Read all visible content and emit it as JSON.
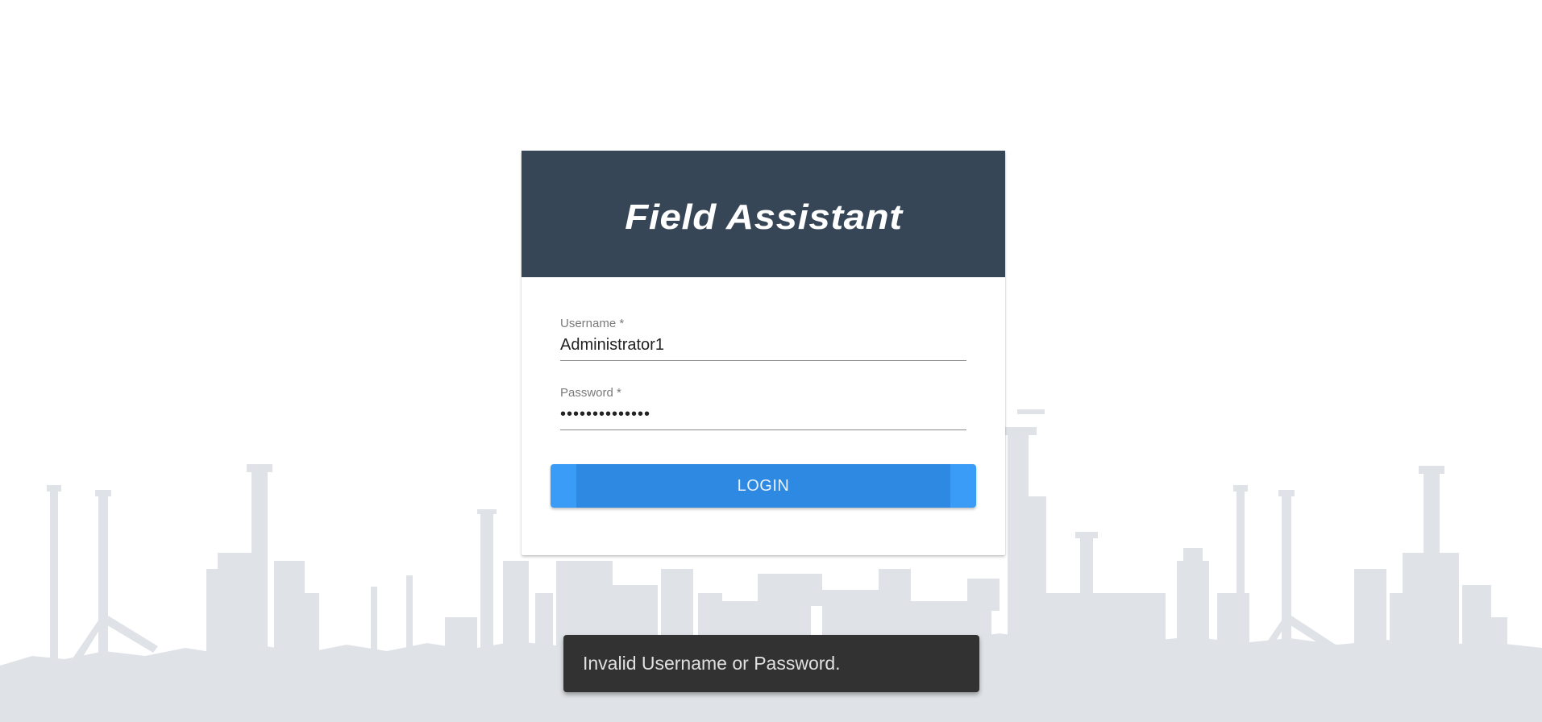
{
  "app": {
    "title": "Field Assistant"
  },
  "login_form": {
    "username": {
      "label": "Username *",
      "value": "Administrator1"
    },
    "password": {
      "label": "Password *",
      "value": "••••••••••••••"
    },
    "login_button_label": "LOGIN"
  },
  "snackbar": {
    "message": "Invalid Username or Password."
  },
  "colors": {
    "header_background": "#374656",
    "button_primary": "#2e89e2",
    "button_edge": "#3a9cf7",
    "snackbar_background": "#323232",
    "skyline": "#dfe3e7"
  },
  "background": {
    "illustration": "industrial-refinery-skyline"
  }
}
